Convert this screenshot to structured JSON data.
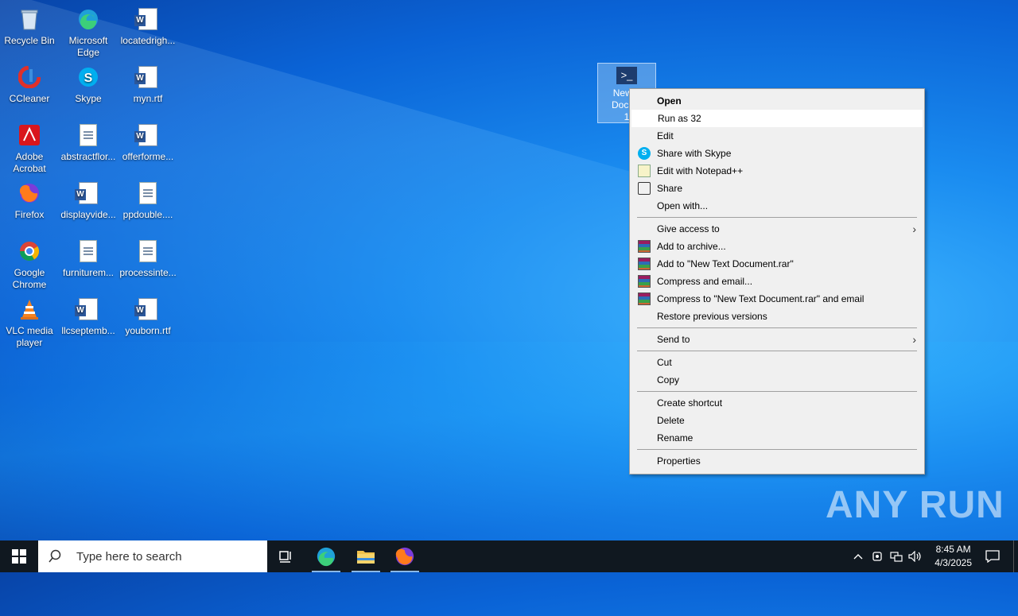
{
  "desktop": {
    "icons": [
      {
        "label": "Recycle Bin"
      },
      {
        "label": "Microsoft Edge"
      },
      {
        "label": "locatedrigh..."
      },
      {
        "label": "CCleaner"
      },
      {
        "label": "Skype"
      },
      {
        "label": "myn.rtf"
      },
      {
        "label": "Adobe Acrobat"
      },
      {
        "label": "abstractflor..."
      },
      {
        "label": "offerforme..."
      },
      {
        "label": "Firefox"
      },
      {
        "label": "displayvide..."
      },
      {
        "label": "ppdouble...."
      },
      {
        "label": "Google Chrome"
      },
      {
        "label": "furniturem..."
      },
      {
        "label": "processinte..."
      },
      {
        "label": "VLC media player"
      },
      {
        "label": "llcseptemb..."
      },
      {
        "label": "youborn.rtf"
      }
    ],
    "selected_file": {
      "label_line1": "New T",
      "label_line2": "Docum",
      "label_line3": "1"
    }
  },
  "context_menu": {
    "items": [
      {
        "label": "Open"
      },
      {
        "label": "Run as 32"
      },
      {
        "label": "Edit"
      },
      {
        "label": "Share with Skype",
        "icon": "skype-icon"
      },
      {
        "label": "Edit with Notepad++",
        "icon": "notepadpp-icon"
      },
      {
        "label": "Share",
        "icon": "share-icon"
      },
      {
        "label": "Open with..."
      },
      {
        "label": "Give access to"
      },
      {
        "label": "Add to archive...",
        "icon": "winrar-icon"
      },
      {
        "label": "Add to \"New Text Document.rar\"",
        "icon": "winrar-icon"
      },
      {
        "label": "Compress and email...",
        "icon": "winrar-icon"
      },
      {
        "label": "Compress to \"New Text Document.rar\" and email",
        "icon": "winrar-icon"
      },
      {
        "label": "Restore previous versions"
      },
      {
        "label": "Send to"
      },
      {
        "label": "Cut"
      },
      {
        "label": "Copy"
      },
      {
        "label": "Create shortcut"
      },
      {
        "label": "Delete"
      },
      {
        "label": "Rename"
      },
      {
        "label": "Properties"
      }
    ]
  },
  "watermark": {
    "text": "ANY RUN"
  },
  "taskbar": {
    "search_placeholder": "Type here to search",
    "clock_time": "8:45 AM",
    "clock_date": "4/3/2025"
  },
  "colors": {
    "accent": "#0a63d6",
    "taskbar": "#101820",
    "menu_bg": "#f0f0f0"
  }
}
